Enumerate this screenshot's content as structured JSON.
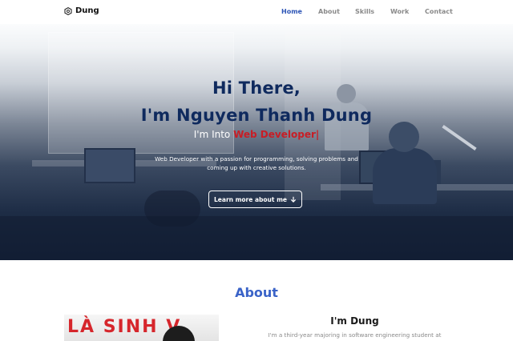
{
  "nav": {
    "brand": "Dung",
    "brand_icon": "hexagon-logo-icon",
    "items": [
      {
        "label": "Home",
        "active": true
      },
      {
        "label": "About",
        "active": false
      },
      {
        "label": "Skills",
        "active": false
      },
      {
        "label": "Work",
        "active": false
      },
      {
        "label": "Contact",
        "active": false
      }
    ],
    "active_color": "#2d55b6"
  },
  "hero": {
    "line1": "Hi There,",
    "line2": "I'm Nguyen Thanh Dung",
    "typed_prefix": "I'm Into ",
    "typed_highlight": "Web Developer|",
    "description": "Web Developer with a passion for programming, solving problems and coming up with creative solutions.",
    "button_label": "Learn more about me",
    "button_icon": "arrow-down-icon",
    "title_color": "#0f2a5e",
    "highlight_color": "#c81d25"
  },
  "about": {
    "title": "About",
    "heading": "I'm Dung",
    "bio": "I'm a third-year majoring in software engineering student at",
    "photo_text": "LÀ SINH V",
    "title_color": "#3a63c8"
  }
}
